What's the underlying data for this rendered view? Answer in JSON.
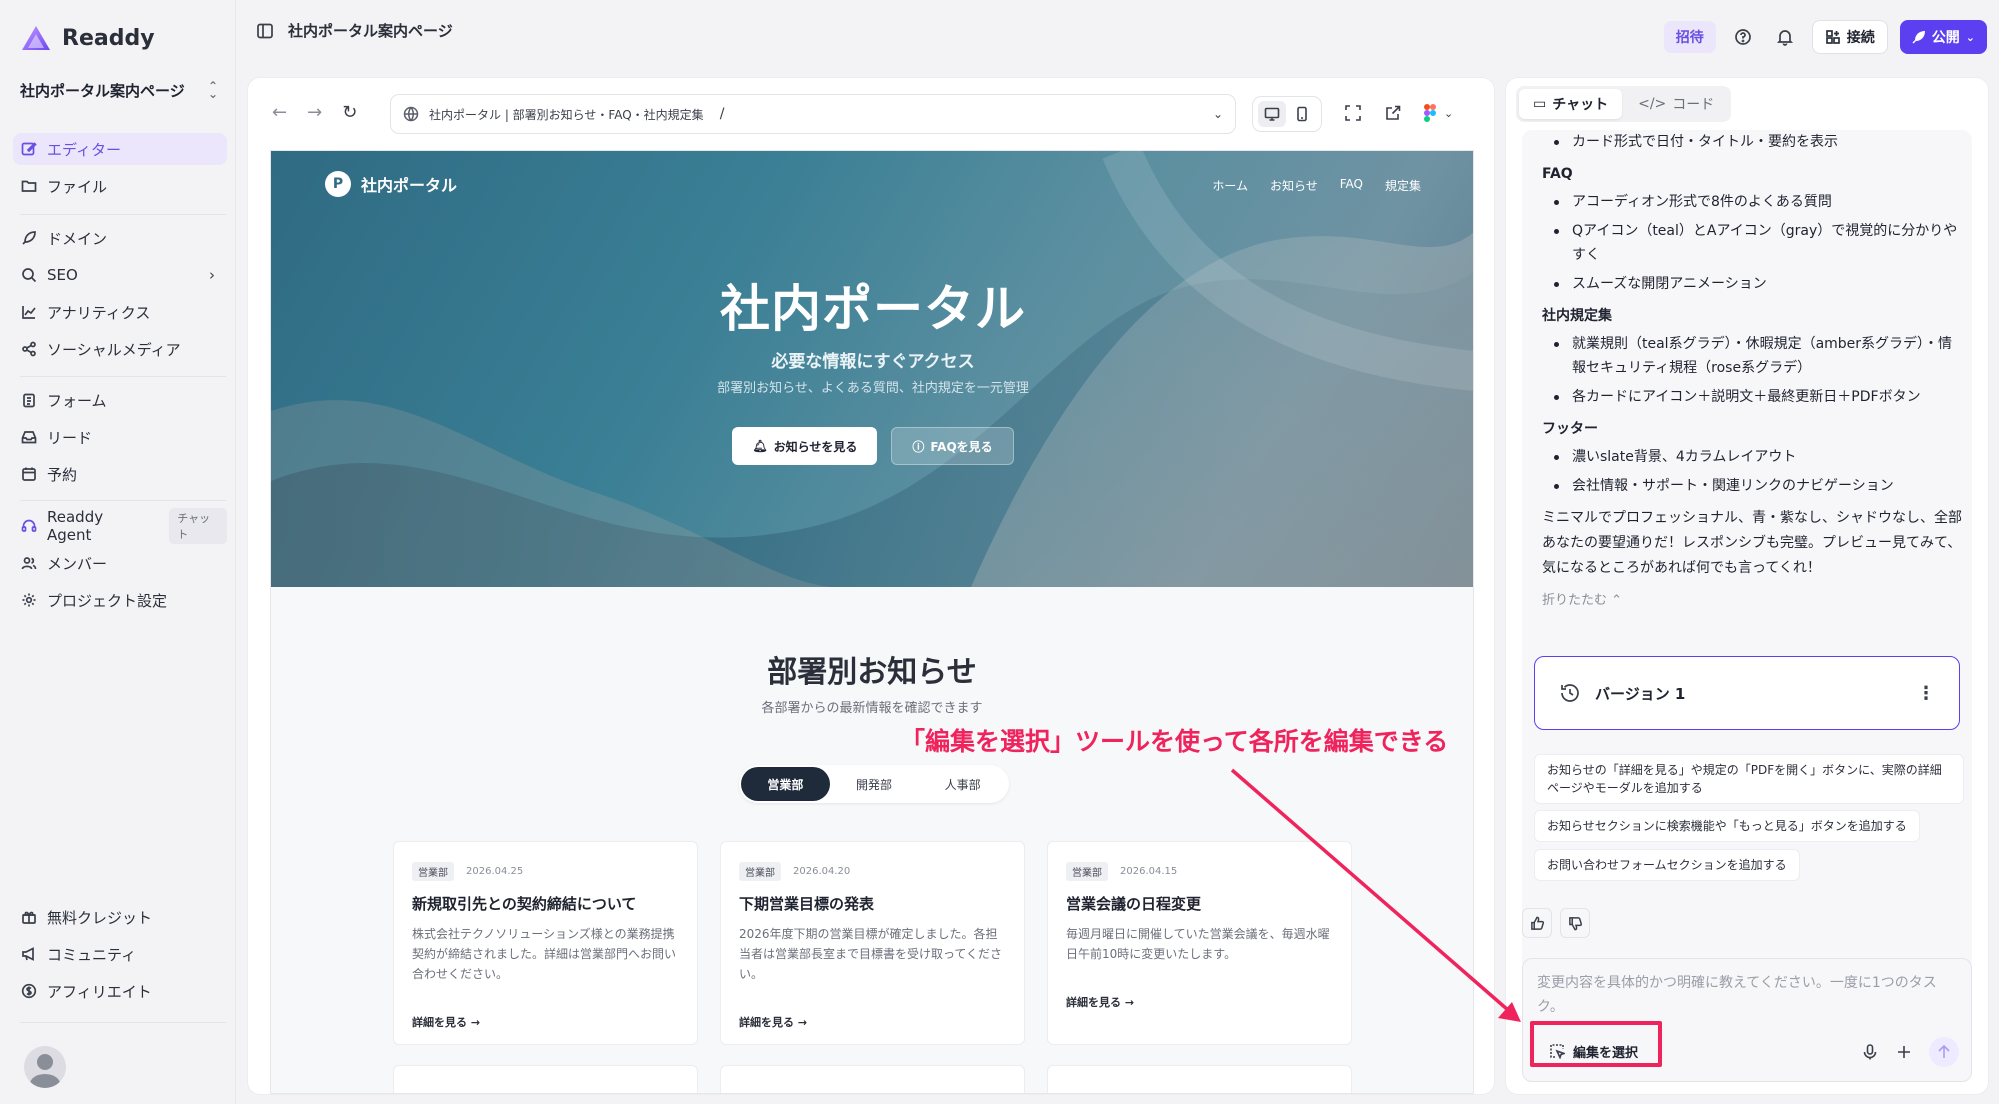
{
  "app": {
    "name": "Readdy",
    "project_name": "社内ポータル案内ページ",
    "colors": {
      "accent": "#5b3ff0",
      "annotation": "#f0245d"
    }
  },
  "sidebar": {
    "items": [
      {
        "label": "エディター",
        "icon": "edit-icon",
        "active": true
      },
      {
        "label": "ファイル",
        "icon": "folder-icon"
      },
      {
        "label": "ドメイン",
        "icon": "rocket-icon"
      },
      {
        "label": "SEO",
        "icon": "search-icon",
        "arrow": "›"
      },
      {
        "label": "アナリティクス",
        "icon": "chart-icon"
      },
      {
        "label": "ソーシャルメディア",
        "icon": "share-icon"
      },
      {
        "label": "フォーム",
        "icon": "clipboard-icon"
      },
      {
        "label": "リード",
        "icon": "inbox-icon"
      },
      {
        "label": "予約",
        "icon": "calendar-icon"
      },
      {
        "label": "Readdy Agent",
        "icon": "headset-icon",
        "tag": "チャット"
      },
      {
        "label": "メンバー",
        "icon": "users-icon"
      },
      {
        "label": "プロジェクト設定",
        "icon": "gear-icon"
      },
      {
        "label": "無料クレジット",
        "icon": "gift-icon"
      },
      {
        "label": "コミュニティ",
        "icon": "megaphone-icon"
      },
      {
        "label": "アフィリエイト",
        "icon": "dollar-icon"
      }
    ]
  },
  "topbar": {
    "title": "社内ポータル案内ページ",
    "invite": "招待",
    "connect": "接続",
    "publish": "公開"
  },
  "browser": {
    "url_title": "社内ポータル | 部署別お知らせ・FAQ・社内規定集",
    "path": "/"
  },
  "site": {
    "logo": "社内ポータル",
    "nav": [
      "ホーム",
      "お知らせ",
      "FAQ",
      "規定集"
    ],
    "hero_title": "社内ポータル",
    "hero_sub": "必要な情報にすぐアクセス",
    "hero_desc": "部署別お知らせ、よくある質問、社内規定を一元管理",
    "btn_news": "お知らせを見る",
    "btn_faq": "FAQを見る",
    "section_title": "部署別お知らせ",
    "section_sub": "各部署からの最新情報を確認できます",
    "tabs": [
      "営業部",
      "開発部",
      "人事部"
    ],
    "cards": [
      {
        "badge": "営業部",
        "date": "2026.04.25",
        "title": "新規取引先との契約締結について",
        "body": "株式会社テクノソリューションズ様との業務提携契約が締結されました。詳細は営業部門へお問い合わせください。",
        "more": "詳細を見る →"
      },
      {
        "badge": "営業部",
        "date": "2026.04.20",
        "title": "下期営業目標の発表",
        "body": "2026年度下期の営業目標が確定しました。各担当者は営業部長室まで目標書を受け取ってください。",
        "more": "詳細を見る →"
      },
      {
        "badge": "営業部",
        "date": "2026.04.15",
        "title": "営業会議の日程変更",
        "body": "毎週月曜日に開催していた営業会議を、毎週水曜日午前10時に変更いたします。",
        "more": "詳細を見る →"
      }
    ]
  },
  "chat": {
    "tab_chat": "チャット",
    "tab_code": "コード",
    "line0": "カード形式で日付・タイトル・要約を表示",
    "faq_h": "FAQ",
    "faq": [
      "アコーディオン形式で8件のよくある質問",
      "Qアイコン（teal）とAアイコン（gray）で視覚的に分かりやすく",
      "スムーズな開閉アニメーション"
    ],
    "rules_h": "社内規定集",
    "rules": [
      "就業規則（teal系グラデ）・休暇規定（amber系グラデ）・情報セキュリティ規程（rose系グラデ）",
      "各カードにアイコン＋説明文＋最終更新日＋PDFボタン"
    ],
    "footer_h": "フッター",
    "footer": [
      "濃いslate背景、4カラムレイアウト",
      "会社情報・サポート・関連リンクのナビゲーション"
    ],
    "closing": "ミニマルでプロフェッショナル、青・紫なし、シャドウなし、全部あなたの要望通りだ！レスポンシブも完璧。プレビュー見てみて、気になるところがあれば何でも言ってくれ！",
    "fold": "折りたたむ ⌃",
    "version": "バージョン 1",
    "suggestions": [
      "お知らせの「詳細を見る」や規定の「PDFを開く」ボタンに、実際の詳細ページやモーダルを追加する",
      "お知らせセクションに検索機能や「もっと見る」ボタンを追加する",
      "お問い合わせフォームセクションを追加する"
    ],
    "placeholder": "変更内容を具体的かつ明確に教えてください。一度に1つのタスク。",
    "edit_select": "編集を選択"
  },
  "annotation": {
    "text": "「編集を選択」ツールを使って各所を編集できる"
  }
}
